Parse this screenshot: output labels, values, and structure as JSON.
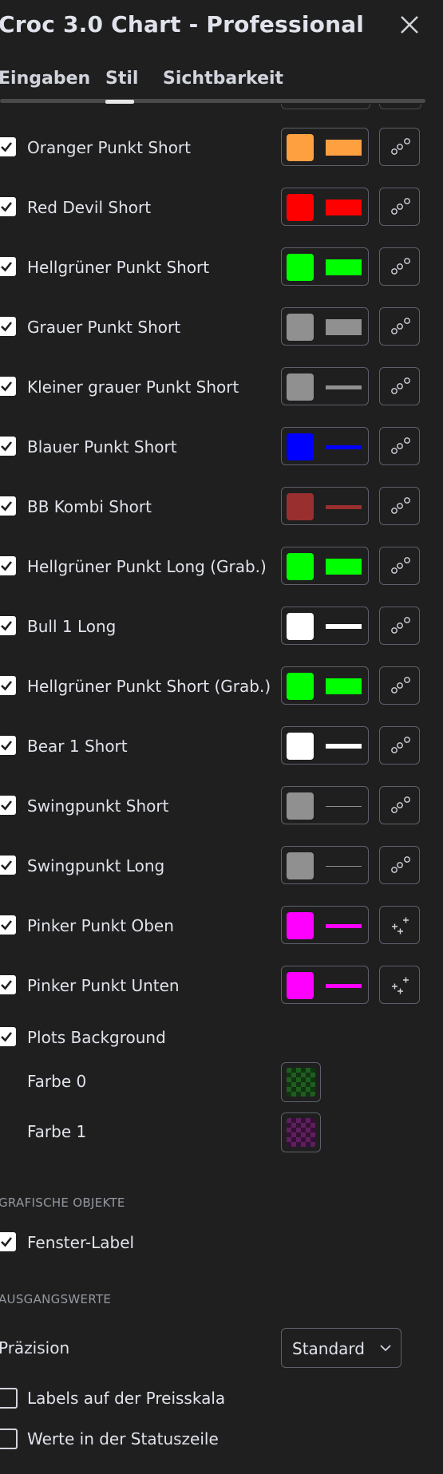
{
  "dialog": {
    "title": "Croc 3.0 Chart - Professional"
  },
  "tabs": [
    "Eingaben",
    "Stil",
    "Sichtbarkeit"
  ],
  "active_tab": "Stil",
  "plots": [
    {
      "label": "Oranger Punkt Short",
      "checked": true,
      "color": "#ffa040",
      "line": "thick",
      "plot_icon": "circles"
    },
    {
      "label": "Red Devil Short",
      "checked": true,
      "color": "#ff0000",
      "line": "thick",
      "plot_icon": "circles"
    },
    {
      "label": "Hellgrüner Punkt Short",
      "checked": true,
      "color": "#00ff00",
      "line": "thick",
      "plot_icon": "circles"
    },
    {
      "label": "Grauer Punkt Short",
      "checked": true,
      "color": "#909090",
      "line": "thick",
      "plot_icon": "circles"
    },
    {
      "label": "Kleiner grauer Punkt Short",
      "checked": true,
      "color": "#909090",
      "line": "medium",
      "plot_icon": "circles"
    },
    {
      "label": "Blauer Punkt Short",
      "checked": true,
      "color": "#0000ff",
      "line": "medium",
      "plot_icon": "circles"
    },
    {
      "label": "BB Kombi Short",
      "checked": true,
      "color": "#9a2f2f",
      "line": "medium",
      "plot_icon": "circles"
    },
    {
      "label": "Hellgrüner Punkt Long (Grab.)",
      "checked": true,
      "color": "#00ff00",
      "line": "thick",
      "plot_icon": "circles"
    },
    {
      "label": "Bull 1 Long",
      "checked": true,
      "color": "#ffffff",
      "line": "bold",
      "plot_icon": "circles"
    },
    {
      "label": "Hellgrüner Punkt Short (Grab.)",
      "checked": true,
      "color": "#00ff00",
      "line": "thick",
      "plot_icon": "circles"
    },
    {
      "label": "Bear 1 Short",
      "checked": true,
      "color": "#ffffff",
      "line": "bold",
      "plot_icon": "circles"
    },
    {
      "label": "Swingpunkt Short",
      "checked": true,
      "color": "#909090",
      "line": "thin",
      "plot_icon": "circles"
    },
    {
      "label": "Swingpunkt Long",
      "checked": true,
      "color": "#909090",
      "line": "thin",
      "plot_icon": "circles"
    },
    {
      "label": "Pinker Punkt Oben",
      "checked": true,
      "color": "#ff00ff",
      "line": "medium",
      "plot_icon": "crosses"
    },
    {
      "label": "Pinker Punkt Unten",
      "checked": true,
      "color": "#ff00ff",
      "line": "medium",
      "plot_icon": "crosses"
    }
  ],
  "plots_background": {
    "label": "Plots Background",
    "checked": true,
    "colors": [
      {
        "label": "Farbe 0",
        "color": "#1f5e1f"
      },
      {
        "label": "Farbe 1",
        "color": "#5e1f5e"
      }
    ]
  },
  "graphic_objects": {
    "section_title": "GRAFISCHE OBJEKTE",
    "window_label": {
      "label": "Fenster-Label",
      "checked": true
    }
  },
  "output_values": {
    "section_title": "AUSGANGSWERTE",
    "precision_label": "Präzision",
    "precision_value": "Standard",
    "scale_labels": {
      "label": "Labels auf der Preisskala",
      "checked": false
    },
    "status_values": {
      "label": "Werte in der Statuszeile",
      "checked": false
    }
  }
}
